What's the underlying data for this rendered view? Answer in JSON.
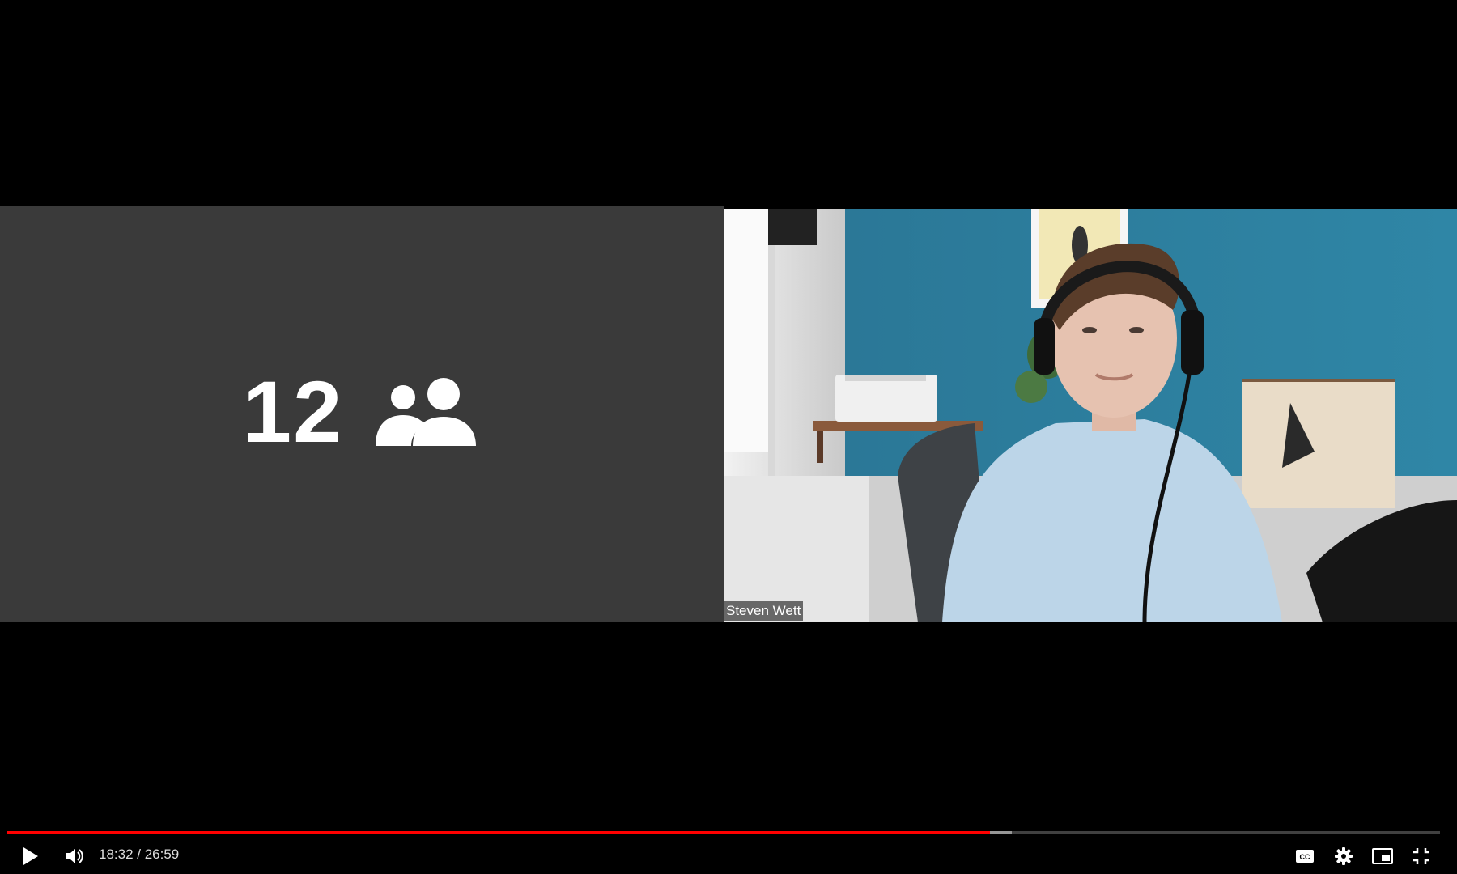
{
  "meeting": {
    "participant_count": "12",
    "people_icon": "people-group-icon",
    "speaker_name": "Steven Wett"
  },
  "player": {
    "current_time": "18:32",
    "separator": " / ",
    "duration": "26:59",
    "played_fraction": 0.686,
    "buffered_fraction": 0.701,
    "accent_color": "#ff0000",
    "icons": {
      "play": "play-icon",
      "volume": "volume-icon",
      "captions": "cc-icon",
      "settings": "gear-icon",
      "miniplayer": "miniplayer-icon",
      "exit_fullscreen": "exit-fullscreen-icon"
    }
  }
}
